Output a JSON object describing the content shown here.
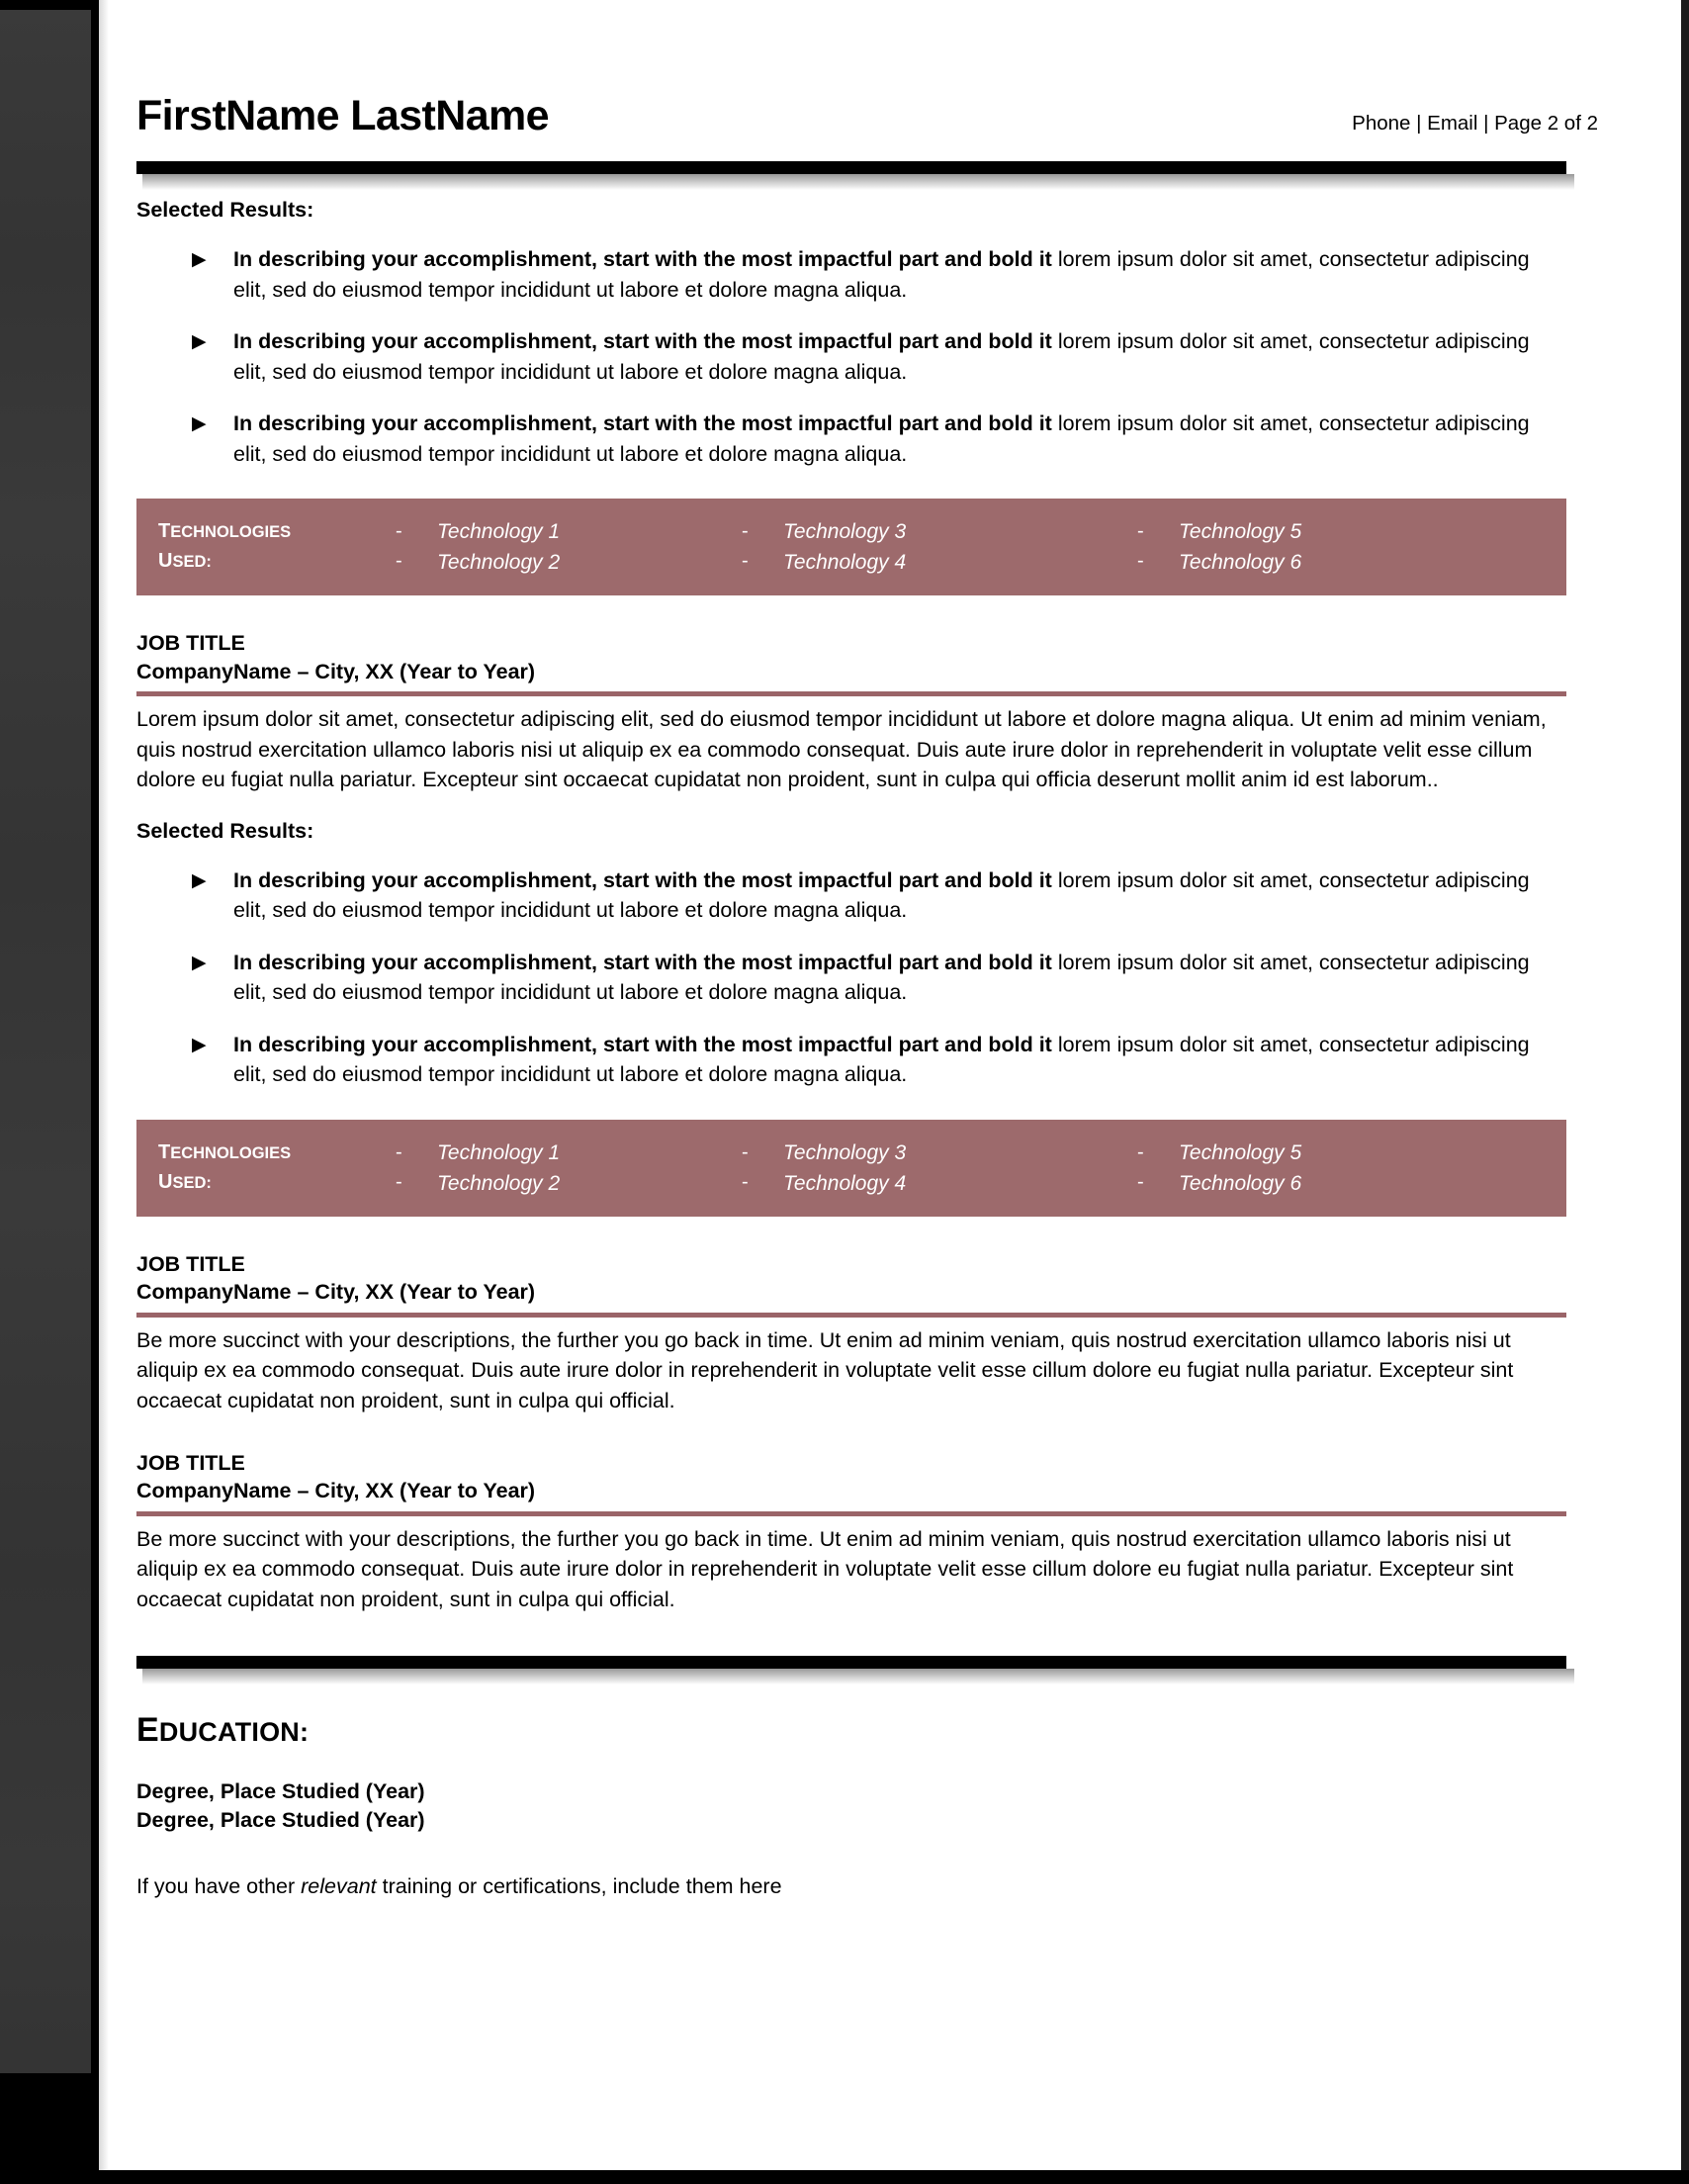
{
  "document": {
    "type": "resume",
    "page_label": "Page 2 of 2"
  },
  "colors": {
    "accent_bar": "#9d6a6c",
    "accent_rule": "#9a6468",
    "rule_black": "#000000",
    "gutter": "#363636"
  },
  "header": {
    "name": "FirstName LastName",
    "contact": "Phone | Email | Page 2 of 2"
  },
  "section_one": {
    "selected_results_label": "Selected Results:",
    "bullets": [
      {
        "bold": "In describing your accomplishment, start with the most impactful part and bold it",
        "rest": " lorem ipsum dolor sit amet, consectetur adipiscing elit, sed do eiusmod tempor incididunt ut labore et dolore magna aliqua."
      },
      {
        "bold": "In describing your accomplishment, start with the most impactful part and bold it",
        "rest": " lorem ipsum dolor sit amet, consectetur adipiscing elit, sed do eiusmod tempor incididunt ut labore et dolore magna aliqua."
      },
      {
        "bold": "In describing your accomplishment, start with the most impactful part and bold it",
        "rest": " lorem ipsum dolor sit amet, consectetur adipiscing elit, sed do eiusmod tempor incididunt ut labore et dolore magna aliqua."
      }
    ]
  },
  "tech_bar_one": {
    "label_line_1_cap": "T",
    "label_line_1_rest": "ECHNOLOGIES",
    "label_line_2_cap": "U",
    "label_line_2_rest": "SED:",
    "dash": "-",
    "col1": [
      "Technology 1",
      "Technology 2"
    ],
    "col2": [
      "Technology 3",
      "Technology 4"
    ],
    "col3": [
      "Technology 5",
      "Technology 6"
    ]
  },
  "job_one": {
    "title": "JOB TITLE",
    "company": "CompanyName – City, XX (Year to Year)",
    "description": "Lorem ipsum dolor sit amet, consectetur adipiscing elit, sed do eiusmod tempor incididunt ut labore et dolore magna aliqua. Ut enim ad minim veniam, quis nostrud exercitation ullamco laboris nisi ut aliquip ex ea commodo consequat. Duis aute irure dolor in reprehenderit in voluptate velit esse cillum dolore eu fugiat nulla pariatur. Excepteur sint occaecat cupidatat non proident, sunt in culpa qui officia deserunt mollit anim id est laborum..",
    "selected_results_label": "Selected Results:",
    "bullets": [
      {
        "bold": "In describing your accomplishment, start with the most impactful part and bold it",
        "rest": " lorem ipsum dolor sit amet, consectetur adipiscing elit, sed do eiusmod tempor incididunt ut labore et dolore magna aliqua."
      },
      {
        "bold": "In describing your accomplishment, start with the most impactful part and bold it",
        "rest": " lorem ipsum dolor sit amet, consectetur adipiscing elit, sed do eiusmod tempor incididunt ut labore et dolore magna aliqua."
      },
      {
        "bold": "In describing your accomplishment, start with the most impactful part and bold it",
        "rest": " lorem ipsum dolor sit amet, consectetur adipiscing elit, sed do eiusmod tempor incididunt ut labore et dolore magna aliqua."
      }
    ]
  },
  "tech_bar_two": {
    "label_line_1_cap": "T",
    "label_line_1_rest": "ECHNOLOGIES",
    "label_line_2_cap": "U",
    "label_line_2_rest": "SED:",
    "dash": "-",
    "col1": [
      "Technology 1",
      "Technology 2"
    ],
    "col2": [
      "Technology 3",
      "Technology 4"
    ],
    "col3": [
      "Technology 5",
      "Technology 6"
    ]
  },
  "job_two": {
    "title": "JOB TITLE",
    "company": "CompanyName – City, XX (Year to Year)",
    "description": "Be more succinct with your descriptions, the further you go back in time. Ut enim ad minim veniam, quis nostrud exercitation ullamco laboris nisi ut aliquip ex ea commodo consequat. Duis aute irure dolor in reprehenderit in voluptate velit esse cillum dolore eu fugiat nulla pariatur. Excepteur sint occaecat cupidatat non proident, sunt in culpa qui official."
  },
  "job_three": {
    "title": "JOB TITLE",
    "company": "CompanyName – City, XX (Year to Year)",
    "description": "Be more succinct with your descriptions, the further you go back in time. Ut enim ad minim veniam, quis nostrud exercitation ullamco laboris nisi ut aliquip ex ea commodo consequat. Duis aute irure dolor in reprehenderit in voluptate velit esse cillum dolore eu fugiat nulla pariatur. Excepteur sint occaecat cupidatat non proident, sunt in culpa qui official."
  },
  "education": {
    "heading_cap": "E",
    "heading_rest": "DUCATION:",
    "degrees": [
      "Degree, Place Studied (Year)",
      "Degree, Place Studied (Year)"
    ],
    "note_before": "If you have other ",
    "note_italic": "relevant",
    "note_after": " training or certifications, include them here"
  },
  "icons": {
    "bullet": "▶"
  }
}
